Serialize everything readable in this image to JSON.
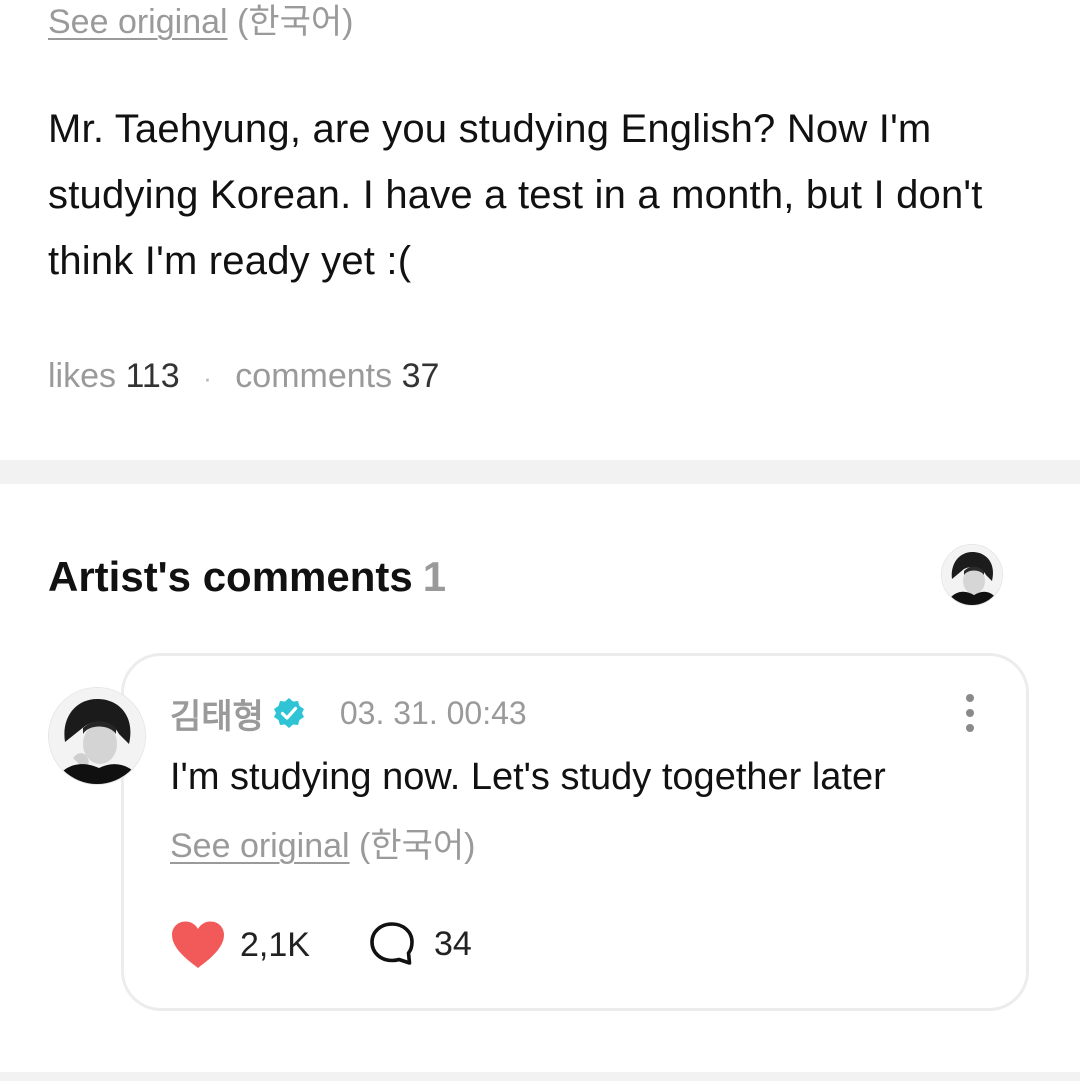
{
  "post": {
    "see_original_link": "See original",
    "see_original_lang": "(한국어)",
    "body": "Mr. Taehyung, are you studying English? Now I'm studying Korean. I have a test in a month, but I don't think I'm ready yet :(",
    "likes_label": "likes",
    "likes_count": "113",
    "separator": "·",
    "comments_label": "comments",
    "comments_count": "37"
  },
  "artist_comments": {
    "title": "Artist's comments",
    "count": "1",
    "comment": {
      "author": "김태형",
      "timestamp": "03. 31. 00:43",
      "text": "I'm studying now. Let's study together later",
      "see_original_link": "See original",
      "see_original_lang": "(한국어)",
      "likes": "2,1K",
      "replies": "34"
    }
  },
  "colors": {
    "heart": "#f25a5a",
    "verified_badge": "#2ec4d6",
    "muted_text": "#9a9a9a",
    "divider": "#f2f2f2"
  },
  "icons": [
    "heart-icon",
    "speech-bubble-icon",
    "verified-badge-icon",
    "more-vertical-icon"
  ]
}
